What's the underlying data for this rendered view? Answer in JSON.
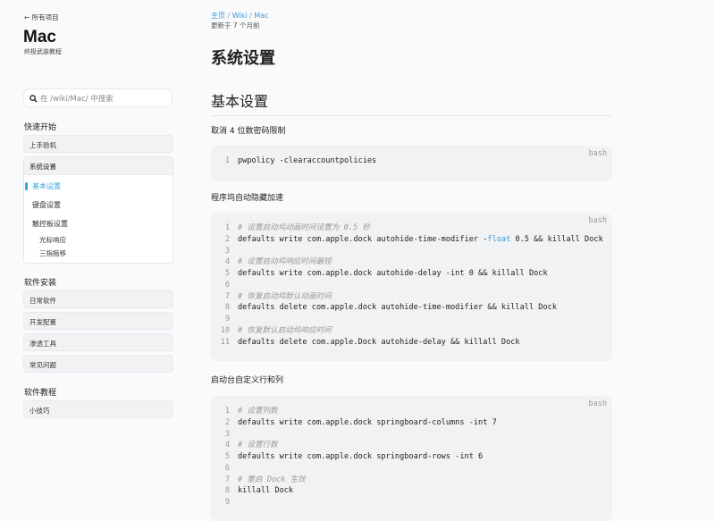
{
  "sidebar": {
    "back_label": "← 所有项目",
    "title": "Mac",
    "subtitle": "终极武装教程",
    "search_placeholder": "在 /wiki/Mac/ 中搜索",
    "sections": [
      {
        "label": "快速开始",
        "items": [
          "上手验机"
        ]
      },
      {
        "label": "软件安装",
        "items": [
          "日常软件",
          "开发配置",
          "渗透工具",
          "常见问题"
        ]
      },
      {
        "label": "软件教程",
        "items": [
          "小技巧"
        ]
      }
    ],
    "open_group": {
      "label": "系统设置",
      "items": [
        "基本设置",
        "键盘设置",
        "触控板设置"
      ],
      "subitems": [
        "光标响应",
        "三指拖移"
      ],
      "active": "基本设置"
    }
  },
  "main": {
    "breadcrumb": [
      "主页",
      "Wiki",
      "Mac"
    ],
    "updated": "更新于 7 个月前",
    "title": "系统设置",
    "section_title": "基本设置",
    "blocks": [
      {
        "heading": "取消 4 位数密码限制",
        "lang": "bash",
        "lines": [
          {
            "n": "1",
            "t": "pwpolicy -clearaccountpolicies"
          }
        ]
      },
      {
        "heading": "程序坞自动隐藏加速",
        "lang": "bash",
        "lines": [
          {
            "n": "1",
            "c": "# 设置启动坞动画时间设置为 0.5 秒"
          },
          {
            "n": "2",
            "t": "defaults write com.apple.dock autohide-time-modifier -",
            "k": "float",
            "t2": " 0.5 && killall Dock"
          },
          {
            "n": "3",
            "t": ""
          },
          {
            "n": "4",
            "c": "# 设置启动坞响应时间最短"
          },
          {
            "n": "5",
            "t": "defaults write com.apple.dock autohide-delay -int 0 && killall Dock"
          },
          {
            "n": "6",
            "t": ""
          },
          {
            "n": "7",
            "c": "# 恢复启动坞默认动画时间"
          },
          {
            "n": "8",
            "t": "defaults delete com.apple.dock autohide-time-modifier && killall Dock"
          },
          {
            "n": "9",
            "t": ""
          },
          {
            "n": "10",
            "c": "# 恢复默认启动坞响应时间"
          },
          {
            "n": "11",
            "t": "defaults delete com.apple.Dock autohide-delay && killall Dock"
          }
        ]
      },
      {
        "heading": "启动台自定义行和列",
        "lang": "bash",
        "lines": [
          {
            "n": "1",
            "c": "# 设置列数"
          },
          {
            "n": "2",
            "t": "defaults write com.apple.dock springboard-columns -int 7"
          },
          {
            "n": "3",
            "t": ""
          },
          {
            "n": "4",
            "c": "# 设置行数"
          },
          {
            "n": "5",
            "t": "defaults write com.apple.dock springboard-rows -int 6"
          },
          {
            "n": "6",
            "t": ""
          },
          {
            "n": "7",
            "c": "# 重启 Dock 生效"
          },
          {
            "n": "8",
            "t": "killall Dock"
          },
          {
            "n": "9",
            "t": ""
          }
        ]
      }
    ]
  },
  "colors": {
    "accent": "#3aa8d8",
    "code_bg": "#f1f2f4",
    "link": "#3a9ad9"
  }
}
